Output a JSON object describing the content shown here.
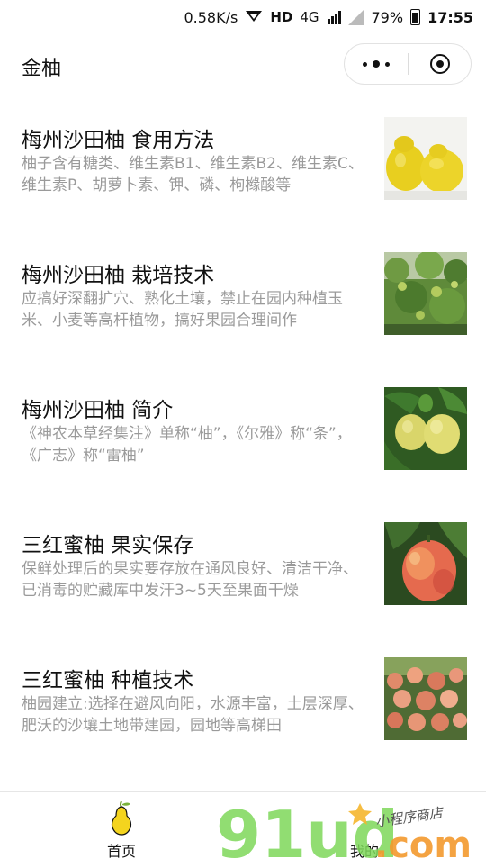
{
  "status_bar": {
    "network_speed": "0.58K/s",
    "hd": "HD",
    "network_type": "4G",
    "battery": "79%",
    "time": "17:55"
  },
  "header": {
    "title": "金柚"
  },
  "articles": [
    {
      "title": "梅州沙田柚 食用方法",
      "desc": "柚子含有糖类、维生素B1、维生素B2、维生素C、维生素P、胡萝卜素、钾、磷、枸橼酸等",
      "thumb": "yellow-pomelos-image"
    },
    {
      "title": "梅州沙田柚 栽培技术",
      "desc": "应搞好深翻扩穴、熟化土壤，禁止在园内种植玉米、小麦等高杆植物，搞好果园合理间作",
      "thumb": "pomelo-tree-image"
    },
    {
      "title": "梅州沙田柚 简介",
      "desc": "《神农本草经集注》单称“柚”，《尔雅》称“条”，《广志》称“雷柚”",
      "thumb": "pomelos-on-branch-image"
    },
    {
      "title": "三红蜜柚 果实保存",
      "desc": "保鲜处理后的果实要存放在通风良好、清洁干净、已消毒的贮藏库中发汗3~5天至果面干燥",
      "thumb": "red-pomelo-image"
    },
    {
      "title": "三红蜜柚 种植技术",
      "desc": "柚园建立:选择在避风向阳，水源丰富，土层深厚、肥沃的沙壤土地带建园，园地等高梯田",
      "thumb": "pomelo-orchard-image"
    }
  ],
  "tabbar": {
    "home_label": "首页",
    "mine_label": "我的"
  },
  "watermark": {
    "logo_text": "91ud",
    "logo_suffix": ".com",
    "tagline": "小程序商店"
  }
}
